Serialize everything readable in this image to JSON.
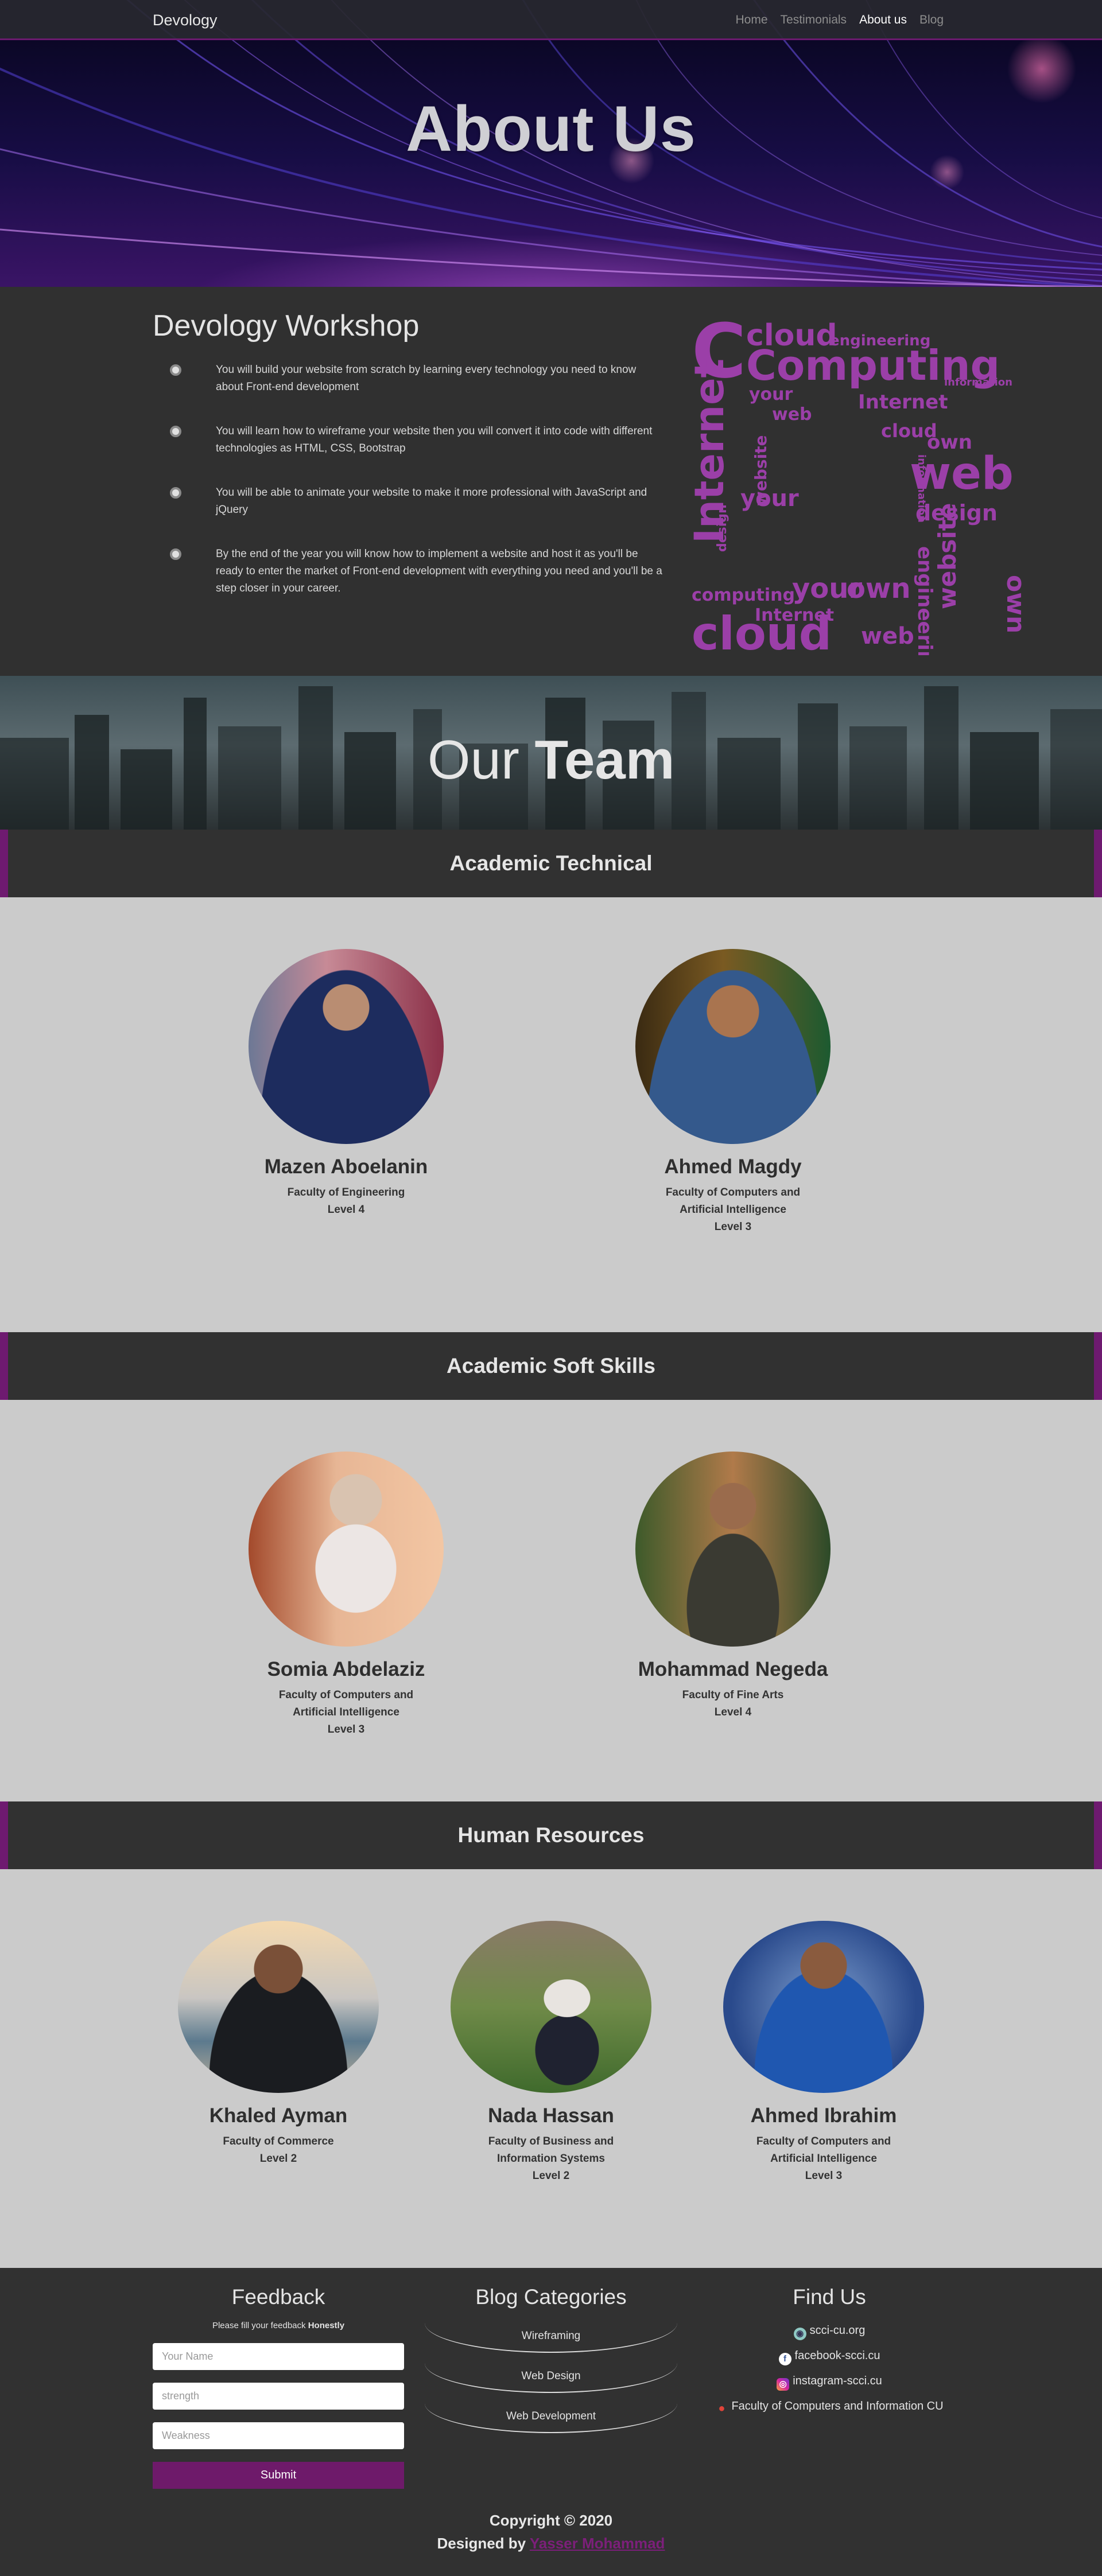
{
  "nav": {
    "brand": "Devology",
    "items": [
      {
        "label": "Home",
        "active": false
      },
      {
        "label": "Testimonials",
        "active": false
      },
      {
        "label": "About us",
        "active": true
      },
      {
        "label": "Blog",
        "active": false
      }
    ]
  },
  "hero": {
    "title": "About Us"
  },
  "workshop": {
    "title": "Devology Workshop",
    "points": [
      "You will build your website from scratch by learning every technology you need to know about Front-end development",
      "You will learn how to wireframe your website then you will convert it into code with different technologies as HTML, CSS, Bootstrap",
      "You will be able to animate your website to make it more professional with JavaScript and jQuery",
      "By the end of the year you will know how to implement a website and host it as you'll be ready to enter the market of Front-end development with everything you need and you'll be a step closer in your career."
    ],
    "word_cloud": [
      "cloud",
      "Computing",
      "Internet",
      "web",
      "design",
      "engineering",
      "information",
      "your",
      "own",
      "website",
      "cloud",
      "computing",
      "Internet",
      "web",
      "your",
      "own",
      "website",
      "engineering",
      "design",
      "information",
      "Internet",
      "cloud",
      "web",
      "your",
      "own"
    ]
  },
  "team_banner": {
    "title_light": "Our",
    "title_bold": "Team"
  },
  "sections": [
    {
      "title": "Academic Technical",
      "members": [
        {
          "name": "Mazen Aboelanin",
          "faculty": "Faculty of Engineering",
          "level": "Level 4"
        },
        {
          "name": "Ahmed Magdy",
          "faculty": "Faculty of Computers and Artificial Intelligence",
          "level": "Level 3"
        }
      ]
    },
    {
      "title": "Academic Soft Skills",
      "members": [
        {
          "name": "Somia Abdelaziz",
          "faculty": "Faculty of Computers and Artificial Intelligence",
          "level": "Level 3"
        },
        {
          "name": "Mohammad Negeda",
          "faculty": "Faculty of Fine Arts",
          "level": "Level 4"
        }
      ]
    },
    {
      "title": "Human Resources",
      "members": [
        {
          "name": "Khaled Ayman",
          "faculty": "Faculty of Commerce",
          "level": "Level 2"
        },
        {
          "name": "Nada Hassan",
          "faculty": "Faculty of Business and Information Systems",
          "level": "Level 2"
        },
        {
          "name": "Ahmed Ibrahim",
          "faculty": "Faculty of Computers and Artificial Intelligence",
          "level": "Level 3"
        }
      ]
    }
  ],
  "footer": {
    "feedback": {
      "title": "Feedback",
      "note_prefix": "Please fill your feedback",
      "note_bold": "Honestly",
      "name_placeholder": "Your Name",
      "strength_placeholder": "strength",
      "weakness_placeholder": "Weakness",
      "submit_label": "Submit"
    },
    "blog": {
      "title": "Blog Categories",
      "categories": [
        "Wireframing",
        "Web Design",
        "Web Development"
      ]
    },
    "find": {
      "title": "Find Us",
      "links": [
        {
          "label": "scci-cu.org",
          "icon": "web-icon"
        },
        {
          "label": "facebook-scci.cu",
          "icon": "facebook-icon"
        },
        {
          "label": "instagram-scci.cu",
          "icon": "instagram-icon"
        },
        {
          "label": "Faculty of Computers and Information CU",
          "icon": "location-pin-icon"
        }
      ]
    },
    "copyright": "Copyright © 2020",
    "designed_by": "Designed by",
    "designer": "Yasser Mohammad"
  },
  "colors": {
    "accent": "#6e1a6e",
    "dark": "#313131",
    "light": "#cbcbcb",
    "cloud_purple": "#9b3fa8"
  }
}
